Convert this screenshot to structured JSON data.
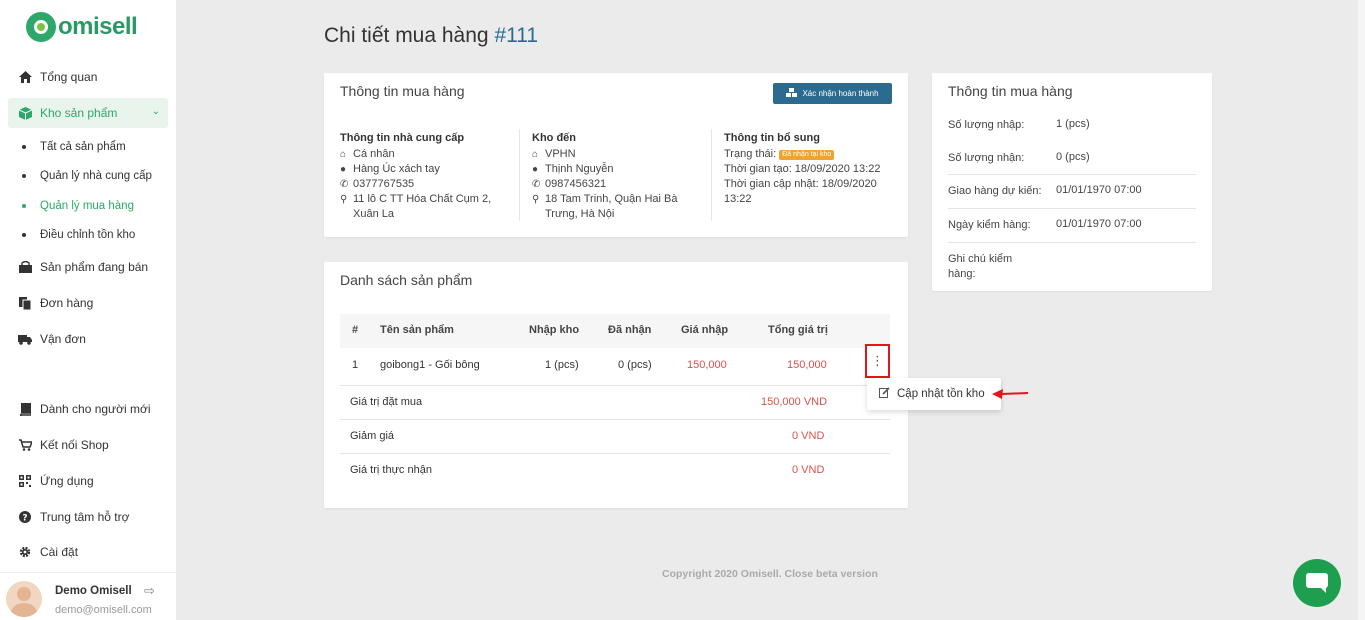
{
  "app": {
    "logo_text": "omisell"
  },
  "sidebar": {
    "items": [
      {
        "label": "Tổng quan",
        "icon": "home-icon"
      },
      {
        "label": "Kho sản phẩm",
        "icon": "box-icon"
      },
      {
        "label": "Sản phẩm đang bán",
        "icon": "shop-icon"
      },
      {
        "label": "Đơn hàng",
        "icon": "copy-icon"
      },
      {
        "label": "Vận đơn",
        "icon": "truck-icon"
      },
      {
        "label": "Dành cho người mới",
        "icon": "book-icon"
      },
      {
        "label": "Kết nối Shop",
        "icon": "cart-icon"
      },
      {
        "label": "Ứng dụng",
        "icon": "qr-icon"
      },
      {
        "label": "Trung tâm hỗ trợ",
        "icon": "help-icon"
      },
      {
        "label": "Cài đặt",
        "icon": "gear-icon"
      }
    ],
    "sub_items": [
      {
        "label": "Tất cả sản phẩm"
      },
      {
        "label": "Quản lý nhà cung cấp"
      },
      {
        "label": "Quản lý mua hàng"
      },
      {
        "label": "Điều chỉnh tồn kho"
      }
    ],
    "user": {
      "name": "Demo Omisell",
      "email": "demo@omisell.com"
    }
  },
  "page": {
    "title": "Chi tiết mua hàng",
    "number": "#111"
  },
  "info_card": {
    "title": "Thông tin mua hàng",
    "confirm_button": "Xác nhận hoàn thành",
    "supplier": {
      "heading": "Thông tin nhà cung cấp",
      "type": "Cá nhân",
      "name": "Hàng Úc xách tay",
      "phone": "0377767535",
      "address": "11 lô C TT Hóa Chất Cụm 2, Xuân La"
    },
    "warehouse": {
      "heading": "Kho đến",
      "name": "VPHN",
      "contact": "Thịnh Nguyễn",
      "phone": "0987456321",
      "address": "18 Tam Trinh, Quận Hai Bà Trưng, Hà Nội"
    },
    "extra": {
      "heading": "Thông tin bổ sung",
      "status_label": "Trạng thái:",
      "status_badge": "Đã nhận tại kho",
      "created": "Thời gian tạo: 18/09/2020 13:22",
      "updated": "Thời gian cập nhật: 18/09/2020 13:22"
    }
  },
  "products_card": {
    "title": "Danh sách sản phẩm",
    "columns": [
      "#",
      "Tên sản phẩm",
      "Nhập kho",
      "Đã nhận",
      "Giá nhập",
      "Tổng giá trị"
    ],
    "rows": [
      {
        "idx": "1",
        "name": "goibong1 - Gối bông",
        "import": "1 (pcs)",
        "received": "0 (pcs)",
        "price": "150,000",
        "total": "150,000"
      }
    ],
    "summary": [
      {
        "label": "Giá trị đặt mua",
        "value": "150,000 VND"
      },
      {
        "label": "Giảm giá",
        "value": "0 VND"
      },
      {
        "label": "Giá trị thực nhận",
        "value": "0 VND"
      }
    ],
    "menu_item": "Cập nhật tồn kho"
  },
  "side_card": {
    "title": "Thông tin mua hàng",
    "rows": [
      {
        "label": "Số lượng nhập:",
        "value": "1 (pcs)"
      },
      {
        "label": "Số lượng nhận:",
        "value": "0 (pcs)"
      },
      {
        "label": "Giao hàng dự kiến:",
        "value": "01/01/1970 07:00"
      },
      {
        "label": "Ngày kiểm hàng:",
        "value": "01/01/1970 07:00"
      },
      {
        "label": "Ghi chú kiểm hàng:",
        "value": ""
      }
    ]
  },
  "footer": {
    "text": "Copyright 2020 Omisell. Close beta version"
  },
  "colors": {
    "brand": "#2ea86a",
    "primary": "#2b6b8f",
    "price": "#d9534f",
    "badge": "#f0a52a",
    "highlight": "#e4151b"
  }
}
